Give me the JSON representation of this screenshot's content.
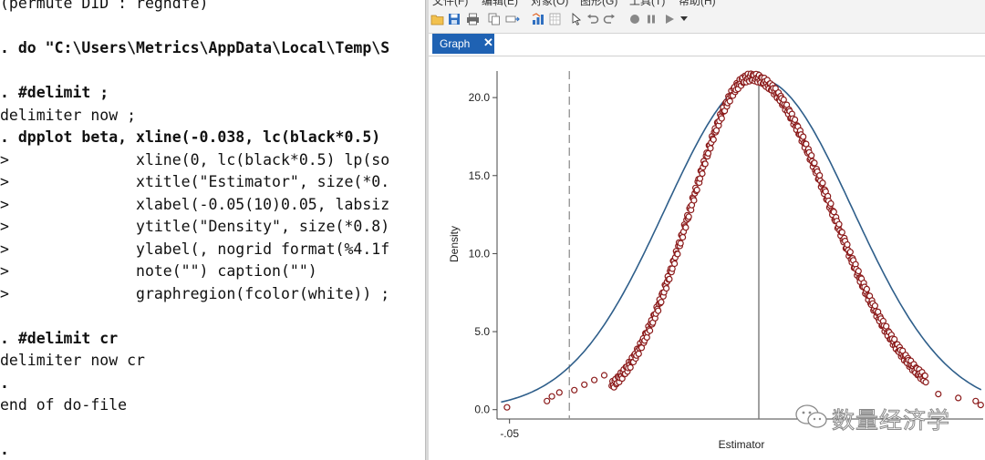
{
  "console": {
    "lines": [
      "(permute DID : regndfe)",
      "",
      ". do \"C:\\Users\\Metrics\\AppData\\Local\\Temp\\S",
      "",
      ". #delimit ;",
      "delimiter now ;",
      ". dpplot beta, xline(-0.038, lc(black*0.5)",
      ">              xline(0, lc(black*0.5) lp(so",
      ">              xtitle(\"Estimator\", size(*0.",
      ">              xlabel(-0.05(10)0.05, labsiz",
      ">              ytitle(\"Density\", size(*0.8)",
      ">              ylabel(, nogrid format(%4.1f",
      ">              note(\"\") caption(\"\")",
      ">              graphregion(fcolor(white)) ;",
      "",
      ". #delimit cr",
      "delimiter now cr",
      ".",
      "end of do-file",
      "",
      "."
    ]
  },
  "graph_window": {
    "menu": [
      "文件(F)",
      "编辑(E)",
      "对象(O)",
      "图形(G)",
      "工具(T)",
      "帮助(H)"
    ],
    "tab_label": "Graph",
    "tab_close": "✕"
  },
  "chart_data": {
    "type": "scatter",
    "xlabel": "Estimator",
    "ylabel": "Density",
    "yticks": [
      "0.0",
      "5.0",
      "10.0",
      "15.0",
      "20.0"
    ],
    "ytick_values": [
      0,
      5,
      10,
      15,
      20
    ],
    "xticks": [
      "-.05"
    ],
    "xtick_values": [
      -0.05
    ],
    "xlim": [
      -0.0525,
      0.045
    ],
    "ylim": [
      -0.6,
      21.7
    ],
    "reference_lines": [
      {
        "x": -0.038,
        "style": "dashed",
        "color": "#999999"
      },
      {
        "x": 0.0,
        "style": "solid",
        "color": "#777777"
      }
    ],
    "normal_curve": {
      "mean": 0.0,
      "sd": 0.0188,
      "peak": 21.2,
      "color": "#2e5e8a"
    },
    "empirical": {
      "mode": -0.0015,
      "peak": 21.3,
      "sd_left": 0.0122,
      "sd_right": 0.016,
      "x_min": -0.0505,
      "x_max": 0.0445,
      "color": "#8b1a1a"
    },
    "isolated_points": [
      {
        "x": -0.0505,
        "y": 0.15
      },
      {
        "x": -0.0425,
        "y": 0.55
      },
      {
        "x": -0.0415,
        "y": 0.85
      },
      {
        "x": -0.04,
        "y": 1.1
      },
      {
        "x": -0.037,
        "y": 1.25
      },
      {
        "x": -0.035,
        "y": 1.6
      },
      {
        "x": -0.033,
        "y": 1.9
      },
      {
        "x": -0.031,
        "y": 2.2
      },
      {
        "x": 0.036,
        "y": 1.0
      },
      {
        "x": 0.04,
        "y": 0.75
      },
      {
        "x": 0.0435,
        "y": 0.55
      },
      {
        "x": 0.0445,
        "y": 0.3
      }
    ]
  },
  "watermark": {
    "text": "数量经济学"
  }
}
